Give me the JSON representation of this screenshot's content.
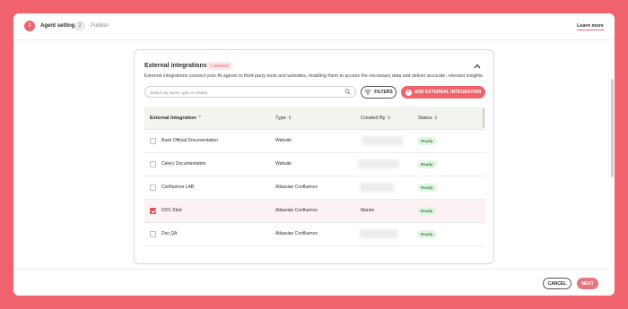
{
  "colors": {
    "accent": "#f0636d",
    "ready_bg": "#e4f5e6",
    "ready_text": "#3a8a47"
  },
  "stepper": {
    "steps": [
      {
        "number": "1",
        "label": "Agent settings",
        "active": true
      },
      {
        "number": "2",
        "label": "Publish",
        "active": false
      }
    ]
  },
  "header": {
    "learn_more": "Learn more"
  },
  "card": {
    "title": "External integrations",
    "badge": "1 selected",
    "collapse_icon": "chevron-up-icon",
    "description": "External integrations connect your AI agents to third-party tools and websites, enabling them to access the necessary data and deliver accurate, relevant insights."
  },
  "search": {
    "placeholder": "Search by name, type or creator",
    "value": "",
    "icon": "search-icon"
  },
  "filters_button": {
    "label": "FILTERS",
    "icon": "filter-lines-icon"
  },
  "add_button": {
    "label": "ADD EXTERNAL INTEGRATION",
    "icon": "plus-circle-icon"
  },
  "table": {
    "columns": [
      {
        "label": "External Integration",
        "sort": "asc"
      },
      {
        "label": "Type",
        "sort": "both"
      },
      {
        "label": "Created By",
        "sort": "both"
      },
      {
        "label": "Status",
        "sort": "both"
      }
    ],
    "rows": [
      {
        "name": "Bash Official Documentation",
        "type": "Website",
        "created_by": "",
        "created_by_blurred": true,
        "status": "Ready",
        "selected": false
      },
      {
        "name": "Celery Documentation",
        "type": "Website",
        "created_by": "",
        "created_by_blurred": true,
        "status": "Ready",
        "selected": false
      },
      {
        "name": "Confluence LAB",
        "type": "Atlassian Confluence",
        "created_by": "",
        "created_by_blurred": true,
        "status": "Ready",
        "selected": false
      },
      {
        "name": "DOC Kbot",
        "type": "Atlassian Confluence",
        "created_by": "Marion",
        "created_by_blurred": false,
        "status": "Ready",
        "selected": true
      },
      {
        "name": "Doc QA",
        "type": "Atlassian Confluence",
        "created_by": "",
        "created_by_blurred": true,
        "status": "Ready",
        "selected": false
      }
    ]
  },
  "footer": {
    "cancel": "CANCEL",
    "next": "NEXT"
  }
}
